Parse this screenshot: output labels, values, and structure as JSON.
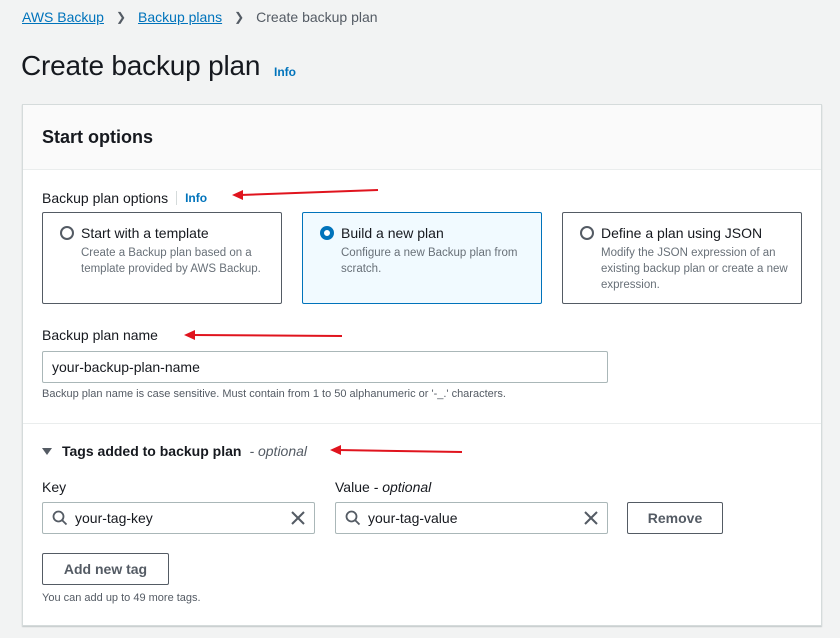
{
  "breadcrumb": {
    "items": [
      "AWS Backup",
      "Backup plans"
    ],
    "current": "Create backup plan"
  },
  "page": {
    "title": "Create backup plan",
    "info": "Info"
  },
  "panel": {
    "title": "Start options"
  },
  "plan_options": {
    "label": "Backup plan options",
    "info": "Info",
    "options": [
      {
        "title": "Start with a template",
        "desc": "Create a Backup plan based on a template provided by AWS Backup.",
        "selected": false
      },
      {
        "title": "Build a new plan",
        "desc": "Configure a new Backup plan from scratch.",
        "selected": true
      },
      {
        "title": "Define a plan using JSON",
        "desc": "Modify the JSON expression of an existing backup plan or create a new expression.",
        "selected": false
      }
    ]
  },
  "plan_name": {
    "label": "Backup plan name",
    "value": "your-backup-plan-name",
    "hint": "Backup plan name is case sensitive. Must contain from 1 to 50 alphanumeric or '-_.' characters."
  },
  "tags": {
    "title": "Tags added to backup plan",
    "optional": "- optional",
    "key_label": "Key",
    "value_label": "Value",
    "value_optional": "- optional",
    "key_value": "your-tag-key",
    "value_value": "your-tag-value",
    "remove_label": "Remove",
    "add_label": "Add new tag",
    "hint": "You can add up to 49 more tags."
  },
  "colors": {
    "link": "#0073bb",
    "annotation_arrow": "#e0141e",
    "selected_bg": "#f1faff"
  }
}
